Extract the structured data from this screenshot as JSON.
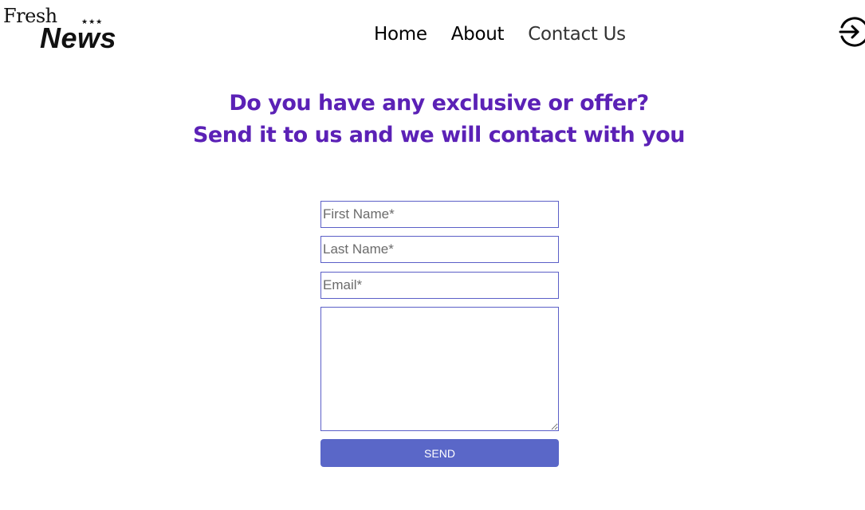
{
  "header": {
    "logo": {
      "line1": "Fresh",
      "line2": "News",
      "stars": "★★★"
    },
    "nav": [
      {
        "label": "Home"
      },
      {
        "label": "About"
      },
      {
        "label": "Contact Us"
      }
    ],
    "login_icon": "sign-in-icon"
  },
  "headline": {
    "line1": "Do you have any exclusive or offer?",
    "line2": "Send it to us and we will contact with you"
  },
  "form": {
    "first_name_placeholder": "First Name*",
    "last_name_placeholder": "Last Name*",
    "email_placeholder": "Email*",
    "message_value": "",
    "send_label": "SEND"
  },
  "colors": {
    "headline": "#5b21b6",
    "input_border": "#5b5fc7",
    "button_bg": "#5a67c8"
  }
}
